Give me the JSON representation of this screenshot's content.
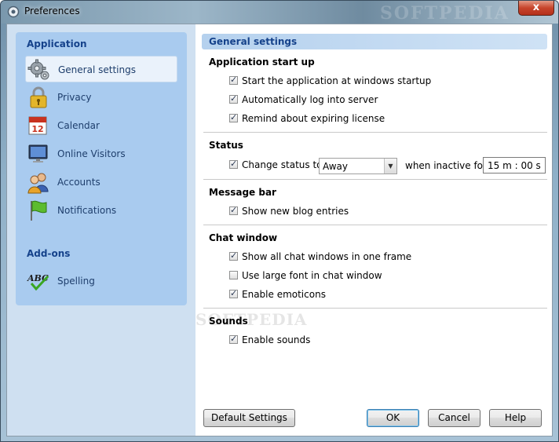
{
  "window": {
    "title": "Preferences",
    "close_glyph": "x",
    "watermark": "SOFTPEDIA"
  },
  "sidebar": {
    "application_heading": "Application",
    "addons_heading": "Add-ons",
    "items": [
      {
        "label": "General settings",
        "icon": "gear-icon",
        "selected": true
      },
      {
        "label": "Privacy",
        "icon": "padlock-icon"
      },
      {
        "label": "Calendar",
        "icon": "calendar-icon"
      },
      {
        "label": "Online Visitors",
        "icon": "monitor-icon"
      },
      {
        "label": "Accounts",
        "icon": "users-icon"
      },
      {
        "label": "Notifications",
        "icon": "flag-icon"
      }
    ],
    "addons": [
      {
        "label": "Spelling",
        "icon": "spelling-abc-icon"
      }
    ],
    "calendar_day": "12"
  },
  "main": {
    "section_title": "General settings",
    "groups": {
      "startup": {
        "title": "Application start up",
        "options": [
          {
            "label": "Start the application at windows startup",
            "checked": true
          },
          {
            "label": "Automatically log into server",
            "checked": true
          },
          {
            "label": "Remind about expiring license",
            "checked": true
          }
        ]
      },
      "status": {
        "title": "Status",
        "change_label": "Change status to",
        "change_checked": true,
        "status_value": "Away",
        "inactive_label": "when inactive for",
        "inactive_value": "15 m : 00 s"
      },
      "message_bar": {
        "title": "Message bar",
        "options": [
          {
            "label": "Show new blog entries",
            "checked": true
          }
        ]
      },
      "chat_window": {
        "title": "Chat window",
        "options": [
          {
            "label": "Show all chat windows in one frame",
            "checked": true
          },
          {
            "label": "Use large font in chat window",
            "checked": false
          },
          {
            "label": "Enable emoticons",
            "checked": true
          }
        ]
      },
      "sounds": {
        "title": "Sounds",
        "options": [
          {
            "label": "Enable sounds",
            "checked": true
          }
        ]
      }
    },
    "watermark": "SOFTPEDIA"
  },
  "buttons": {
    "default_settings": "Default Settings",
    "ok": "OK",
    "cancel": "Cancel",
    "help": "Help"
  },
  "colors": {
    "sidebar_panel": "#a9cbef",
    "heading_blue": "#15428b",
    "close_red": "#c7452c"
  }
}
